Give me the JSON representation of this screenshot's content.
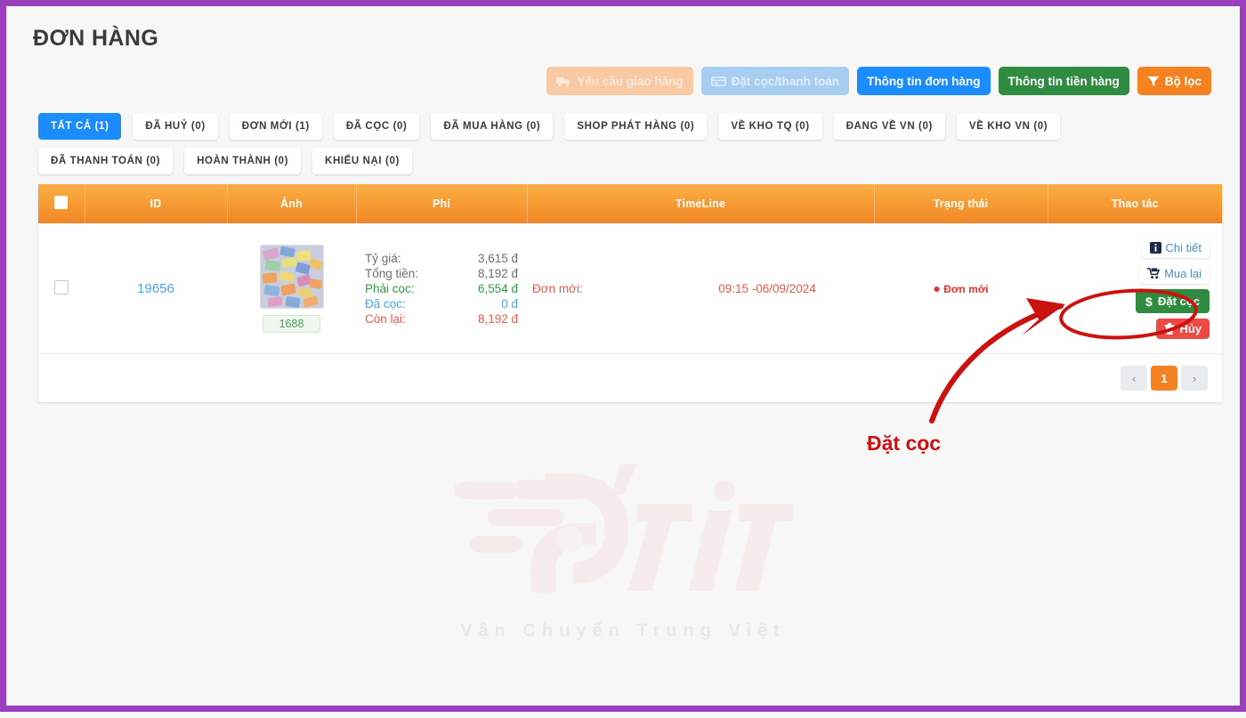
{
  "page": {
    "title": "ĐƠN HÀNG",
    "border_color": "#9b3fbe",
    "background": "#f7f7f7"
  },
  "toolbar": {
    "buttons": [
      {
        "label": "Yêu cầu giao hàng",
        "icon": "truck-icon",
        "state": "disabled",
        "color": "#f8c9a3"
      },
      {
        "label": "Đặt cọc/thanh toán",
        "icon": "credit-card-icon",
        "state": "disabled",
        "color": "#a7cdf1"
      },
      {
        "label": "Thông tin đơn hàng",
        "icon": "",
        "state": "enabled",
        "color": "#1a8cfb"
      },
      {
        "label": "Thông tin tiền hàng",
        "icon": "",
        "state": "enabled",
        "color": "#2e8b40"
      },
      {
        "label": "Bộ lọc",
        "icon": "filter-icon",
        "state": "enabled",
        "color": "#f58220"
      }
    ]
  },
  "tabs": [
    {
      "label": "TẤT CẢ",
      "count": "(1)",
      "active": true
    },
    {
      "label": "ĐÃ HUỶ",
      "count": "(0)",
      "active": false
    },
    {
      "label": "ĐƠN MỚI",
      "count": "(1)",
      "active": false
    },
    {
      "label": "ĐÃ CỌC",
      "count": "(0)",
      "active": false
    },
    {
      "label": "ĐÃ MUA HÀNG",
      "count": "(0)",
      "active": false
    },
    {
      "label": "SHOP PHÁT HÀNG",
      "count": "(0)",
      "active": false
    },
    {
      "label": "VỀ KHO TQ",
      "count": "(0)",
      "active": false
    },
    {
      "label": "ĐANG VỀ VN",
      "count": "(0)",
      "active": false
    },
    {
      "label": "VỀ KHO VN",
      "count": "(0)",
      "active": false
    },
    {
      "label": "ĐÃ THANH TOÁN",
      "count": "(0)",
      "active": false
    },
    {
      "label": "HOÀN THÀNH",
      "count": "(0)",
      "active": false
    },
    {
      "label": "KHIẾU NẠI",
      "count": "(0)",
      "active": false
    }
  ],
  "table": {
    "headers": [
      "",
      "ID",
      "Ảnh",
      "Phí",
      "TimeLine",
      "Trạng thái",
      "Thao tác"
    ],
    "rows": [
      {
        "selected": false,
        "id": "19656",
        "image_badge": "1688",
        "fees": [
          {
            "label": "Tỷ giá:",
            "value": "3,615 đ",
            "label_color": "#6e6e6e",
            "value_color": "#6e6e6e"
          },
          {
            "label": "Tổng tiền:",
            "value": "8,192 đ",
            "label_color": "#6e6e6e",
            "value_color": "#6e6e6e"
          },
          {
            "label": "Phải cọc:",
            "value": "6,554 đ",
            "label_color": "#2f9e45",
            "value_color": "#2f9e45"
          },
          {
            "label": "Đã cọc:",
            "value": "0 đ",
            "label_color": "#4aa3e8",
            "value_color": "#4aa3e8"
          },
          {
            "label": "Còn lại:",
            "value": "8,192 đ",
            "label_color": "#e85a4a",
            "value_color": "#e85a4a"
          }
        ],
        "timeline_label": "Đơn mới:",
        "timeline_time": "09:15 -06/09/2024",
        "status": "Đơn mới",
        "actions": [
          {
            "label": "Chi tiết",
            "icon": "info-icon",
            "style": "light"
          },
          {
            "label": "Mua lại",
            "icon": "cart-icon",
            "style": "light"
          },
          {
            "label": "Đặt cọc",
            "icon": "dollar-icon",
            "style": "green"
          },
          {
            "label": "Hủy",
            "icon": "trash-icon",
            "style": "red"
          }
        ]
      }
    ]
  },
  "pagination": {
    "prev": "‹",
    "next": "›",
    "pages": [
      "1"
    ],
    "current": "1"
  },
  "annotation": {
    "label": "Đặt cọc",
    "color": "#cc1111"
  },
  "watermark": {
    "brand": "P'tite",
    "tagline": "Vận Chuyển Trung Việt"
  }
}
